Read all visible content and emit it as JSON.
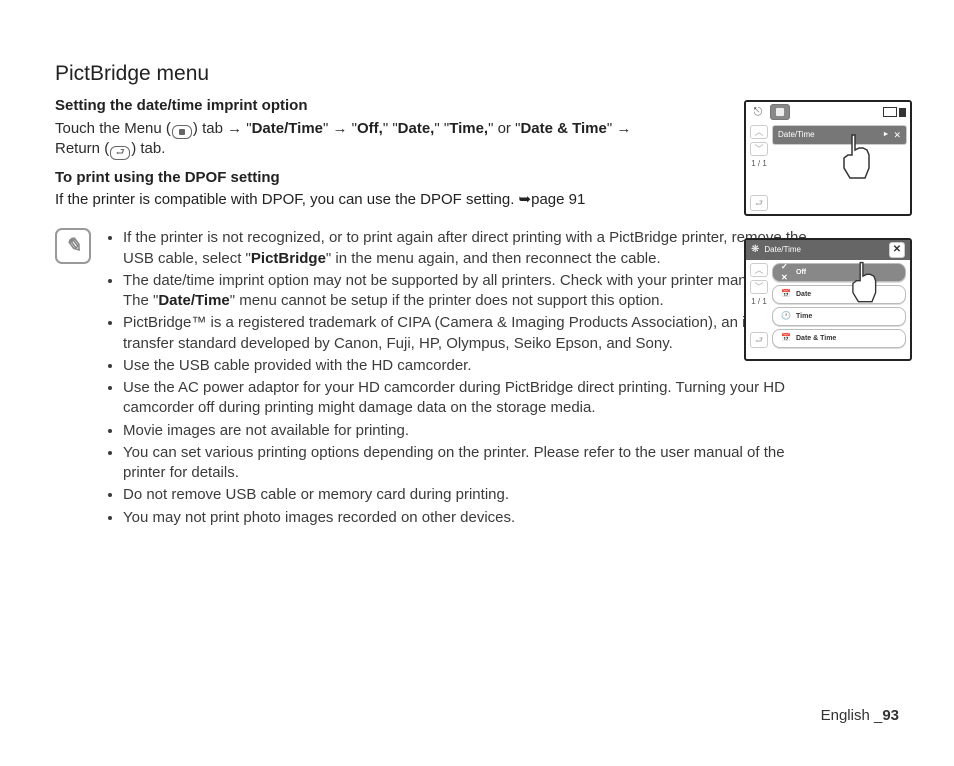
{
  "title": "PictBridge menu",
  "subheading1": "Setting the date/time imprint option",
  "intro": {
    "touch": "Touch the Menu (",
    "tab_after": ") tab ",
    "arrow": "→",
    "date_time": "Date/Time",
    "off": "Off,",
    "date": "Date,",
    "time": "Time,",
    "or": " or ",
    "date_and_time": "Date & Time",
    "return": "Return (",
    "return_tab_after": ") tab."
  },
  "subheading2": "To print using the DPOF setting",
  "dpof_line": {
    "text": "If the printer is compatible with DPOF, you can use the DPOF setting. ",
    "page_arrow": "➥",
    "page": "page 91"
  },
  "notes": [
    {
      "pre": "If the printer is not recognized, or to print again after direct printing with a PictBridge printer, remove the USB cable, select \"",
      "bold": "PictBridge",
      "post": "\" in the menu again, and then reconnect the cable."
    },
    {
      "pre": "The date/time imprint option may not be supported by all printers. Check with your printer manufacturer. The \"",
      "bold": "Date/Time",
      "post": "\" menu cannot be setup if the printer does not support this option."
    },
    {
      "text": "PictBridge™ is a registered trademark of CIPA (Camera & Imaging Products Association), an image transfer standard developed by Canon, Fuji, HP, Olympus, Seiko Epson, and Sony."
    },
    {
      "text": "Use the USB cable provided with the HD camcorder."
    },
    {
      "text": "Use the AC power adaptor for your HD camcorder during PictBridge direct printing. Turning your HD camcorder off during printing might damage data on the storage media."
    },
    {
      "text": "Movie images are not available for printing."
    },
    {
      "text": "You can set various printing options depending on the printer. Please refer to the user manual of the printer for details."
    },
    {
      "text": "Do not remove USB cable or memory card during printing."
    },
    {
      "text": "You may not print photo images recorded on other devices."
    }
  ],
  "footer": {
    "lang": "English ",
    "sep": "_",
    "page": "93"
  },
  "shot1": {
    "side_pager": "1 / 1",
    "row_label": "Date/Time",
    "row_play": "►",
    "row_cross": "✕"
  },
  "shot2": {
    "title": "Date/Time",
    "side_pager": "1 / 1",
    "options": {
      "off": {
        "icon": "✓ ✕",
        "label": "Off"
      },
      "date": {
        "icon": "📅",
        "label": "Date"
      },
      "time": {
        "icon": "🕐",
        "label": "Time"
      },
      "dt": {
        "icon": "📅",
        "label": "Date & Time"
      }
    }
  }
}
